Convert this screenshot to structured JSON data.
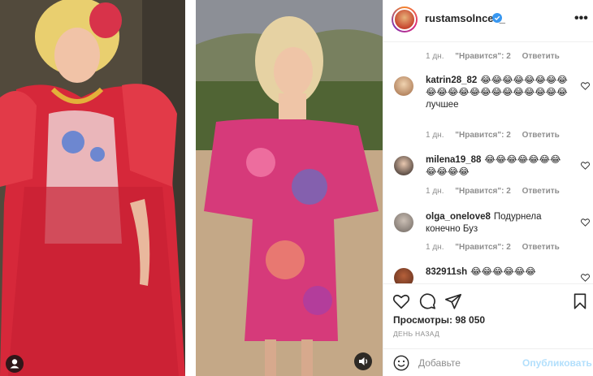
{
  "post": {
    "author": "rustamsolncev_",
    "verified": true,
    "views_label": "Просмотры: 98 050",
    "date_label": "ДЕНЬ НАЗАД"
  },
  "comment_meta": {
    "time": "1 дн.",
    "likes": "\"Нравится\": 2",
    "reply": "Ответить"
  },
  "comments": [
    {
      "user": "katrin28_82",
      "text": "😂😂😂😂😂😂😂😂😂😂😂😂😂😂😂😂😂😂😂😂😂 лучшее"
    },
    {
      "user": "milena19_88",
      "text": "😂😂😂😂😂😂😂😂😂😂😂"
    },
    {
      "user": "olga_onelove8",
      "text": "Подурнела конечно Буз"
    },
    {
      "user": "832911sh",
      "text": "😂😂😂😂😂😂"
    }
  ],
  "input": {
    "placeholder": "Добавьте",
    "publish_label": "Опубликовать"
  },
  "icons": {
    "more": "more-horizontal-icon",
    "like": "heart-icon",
    "comment": "comment-bubble-icon",
    "share": "paper-plane-icon",
    "save": "bookmark-icon",
    "emoji": "smiley-icon",
    "sound": "speaker-icon",
    "user_tag": "user-tag-icon"
  },
  "colors": {
    "accent_verified": "#3897f0",
    "publish_disabled": "#b2dffc",
    "muted_text": "#8e8e8e"
  }
}
